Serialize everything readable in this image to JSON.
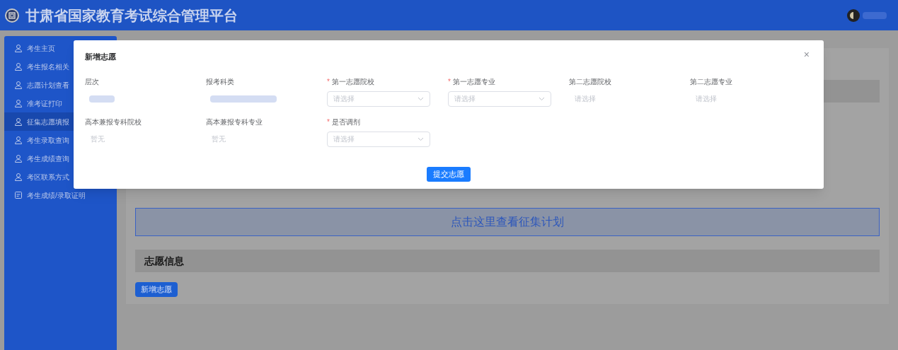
{
  "header": {
    "title": "甘肃省国家教育考试综合管理平台"
  },
  "sidebar": {
    "items": [
      {
        "label": "考生主页",
        "kind": "person",
        "selected": false
      },
      {
        "label": "考生报名相关",
        "kind": "person",
        "selected": false
      },
      {
        "label": "志愿计划查看",
        "kind": "person",
        "selected": false
      },
      {
        "label": "准考证打印",
        "kind": "person",
        "selected": false
      },
      {
        "label": "征集志愿填报",
        "kind": "person",
        "selected": true
      },
      {
        "label": "考生录取查询",
        "kind": "person",
        "selected": false
      },
      {
        "label": "考生成绩查询",
        "kind": "person",
        "selected": false
      },
      {
        "label": "考区联系方式",
        "kind": "person",
        "selected": false
      },
      {
        "label": "考生成绩/录取证明",
        "kind": "document",
        "selected": false
      }
    ]
  },
  "main": {
    "plan_link": "点击这里查看征集计划",
    "section_title": "志愿信息",
    "add_button": "新增志愿"
  },
  "dialog": {
    "title": "新增志愿",
    "close": "×",
    "fields": [
      {
        "label": "层次",
        "kind": "hidden-value"
      },
      {
        "label": "报考科类",
        "kind": "hidden-value"
      },
      {
        "required_mark": "*",
        "label": "第一志愿院校",
        "kind": "select",
        "placeholder": "请选择"
      },
      {
        "required_mark": "*",
        "label": "第一志愿专业",
        "kind": "select",
        "placeholder": "请选择"
      },
      {
        "label": "第二志愿院校",
        "kind": "plain",
        "placeholder": "请选择"
      },
      {
        "label": "第二志愿专业",
        "kind": "plain",
        "placeholder": "请选择"
      },
      {
        "label": "高本兼报专科院校",
        "kind": "plain",
        "placeholder": "暂无"
      },
      {
        "label": "高本兼报专科专业",
        "kind": "plain",
        "placeholder": "暂无"
      },
      {
        "required_mark": "*",
        "label": "是否调剂",
        "kind": "select",
        "placeholder": "请选择"
      }
    ],
    "submit": "提交志愿"
  }
}
